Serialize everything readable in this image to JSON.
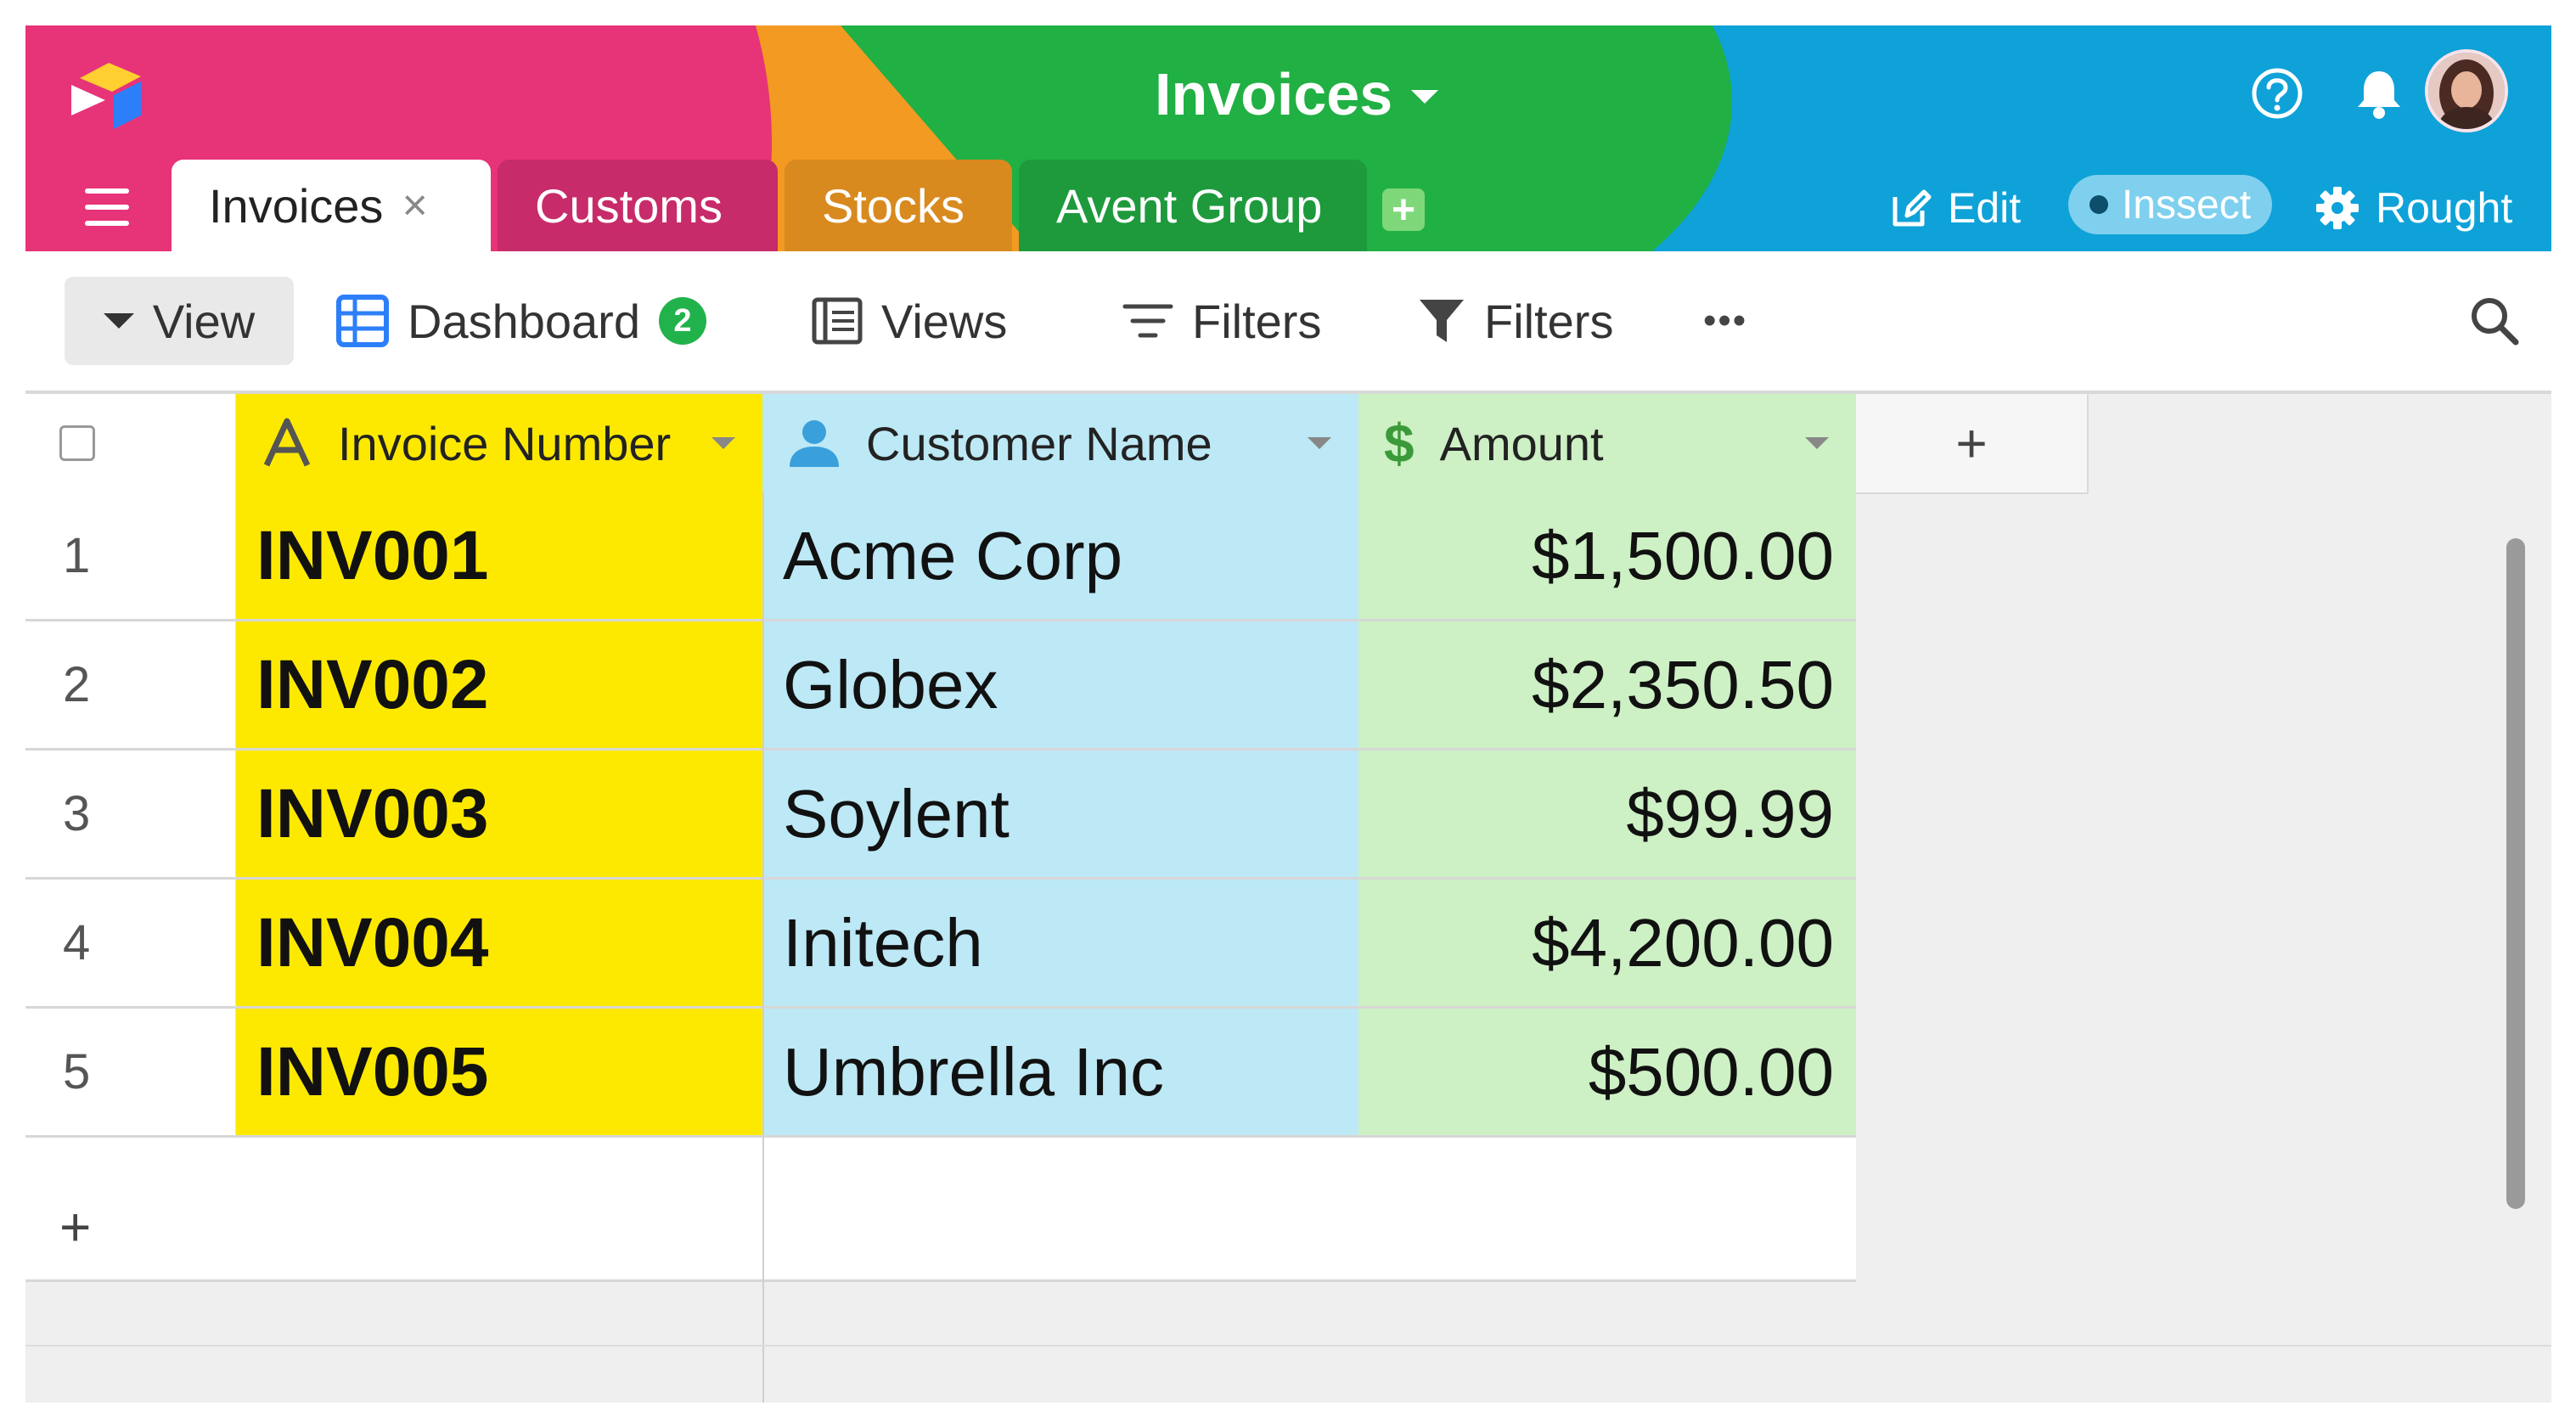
{
  "app": {
    "base_title": "Invoices"
  },
  "header": {
    "tabs": [
      {
        "label": "Invoices",
        "active": true,
        "closable": true
      },
      {
        "label": "Customs"
      },
      {
        "label": "Stocks"
      },
      {
        "label": "Avent Group"
      }
    ],
    "close_glyph": "×",
    "add_tab_glyph": "+",
    "edit_label": "Edit",
    "pill_label": "Inssect",
    "settings_label": "Rought",
    "icons": [
      "help-icon",
      "bell-icon",
      "user-avatar",
      "menu-icon",
      "edit-icon",
      "gear-icon"
    ],
    "colors": {
      "pink": "#e73378",
      "orange": "#f39a22",
      "green": "#21b043",
      "blue": "#0ea2d8"
    }
  },
  "toolbar": {
    "view_label": "View",
    "dashboard_label": "Dashboard",
    "dashboard_badge": "2",
    "views_label": "Views",
    "filters_label": "Filters",
    "filters2_label": "Filters",
    "more_glyph": "•••",
    "icons": [
      "grid-icon",
      "list-icon",
      "sort-icon",
      "funnel-icon",
      "search-icon"
    ]
  },
  "grid": {
    "columns": [
      {
        "label": "Invoice Number",
        "type": "text",
        "color": "#fde900"
      },
      {
        "label": "Customer Name",
        "type": "user",
        "color": "#bde8f5"
      },
      {
        "label": "Amount",
        "type": "currency",
        "color": "#cdf0c4"
      }
    ],
    "add_column_glyph": "+",
    "add_row_glyph": "+",
    "rows": [
      {
        "num": "1",
        "invoice": "INV001",
        "customer": "Acme Corp",
        "amount": "$1,500.00"
      },
      {
        "num": "2",
        "invoice": "INV002",
        "customer": "Globex",
        "amount": "$2,350.50"
      },
      {
        "num": "3",
        "invoice": "INV003",
        "customer": "Soylent",
        "amount": "$99.99"
      },
      {
        "num": "4",
        "invoice": "INV004",
        "customer": "Initech",
        "amount": "$4,200.00"
      },
      {
        "num": "5",
        "invoice": "INV005",
        "customer": "Umbrella Inc",
        "amount": "$500.00"
      }
    ]
  }
}
